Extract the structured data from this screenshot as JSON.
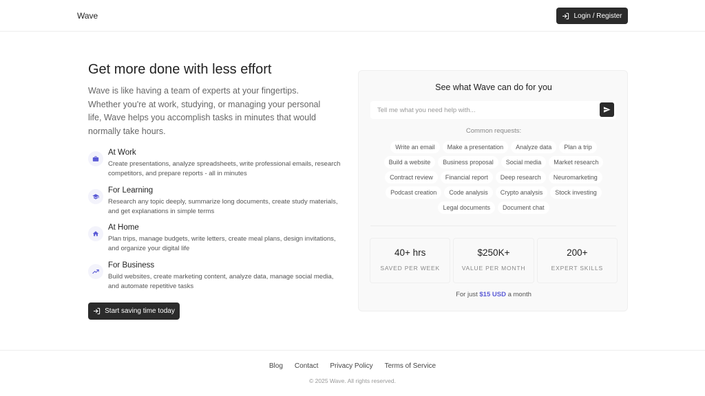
{
  "header": {
    "brand": "Wave",
    "login_label": "Login / Register"
  },
  "hero": {
    "title": "Get more done with less effort",
    "description": "Wave is like having a team of experts at your fingertips. Whether you're at work, studying, or managing your personal life, Wave helps you accomplish tasks in minutes that would normally take hours."
  },
  "features": [
    {
      "icon": "briefcase-icon",
      "title": "At Work",
      "description": "Create presentations, analyze spreadsheets, write professional emails, research competitors, and prepare reports - all in minutes"
    },
    {
      "icon": "graduation-cap-icon",
      "title": "For Learning",
      "description": "Research any topic deeply, summarize long documents, create study materials, and get explanations in simple terms"
    },
    {
      "icon": "home-icon",
      "title": "At Home",
      "description": "Plan trips, manage budgets, write letters, create meal plans, design invitations, and organize your digital life"
    },
    {
      "icon": "trending-up-icon",
      "title": "For Business",
      "description": "Build websites, create marketing content, analyze data, manage social media, and automate repetitive tasks"
    }
  ],
  "cta_label": "Start saving time today",
  "card": {
    "title": "See what Wave can do for you",
    "input_placeholder": "Tell me what you need help with...",
    "common_label": "Common requests:",
    "chips": [
      "Write an email",
      "Make a presentation",
      "Analyze data",
      "Plan a trip",
      "Build a website",
      "Business proposal",
      "Social media",
      "Market research",
      "Contract review",
      "Financial report",
      "Deep research",
      "Neuromarketing",
      "Podcast creation",
      "Code analysis",
      "Crypto analysis",
      "Stock investing",
      "Legal documents",
      "Document chat"
    ],
    "stats": [
      {
        "value": "40+ hrs",
        "label": "SAVED PER WEEK"
      },
      {
        "value": "$250K+",
        "label": "VALUE PER MONTH"
      },
      {
        "value": "200+",
        "label": "EXPERT SKILLS"
      }
    ],
    "price_prefix": "For just",
    "price_amount": "$15 USD",
    "price_suffix": "a month"
  },
  "footer": {
    "links": [
      "Blog",
      "Contact",
      "Privacy Policy",
      "Terms of Service"
    ],
    "copyright": "© 2025 Wave. All rights reserved."
  },
  "colors": {
    "accent": "#5b5bd6",
    "dark_button": "#2b2b2b"
  }
}
